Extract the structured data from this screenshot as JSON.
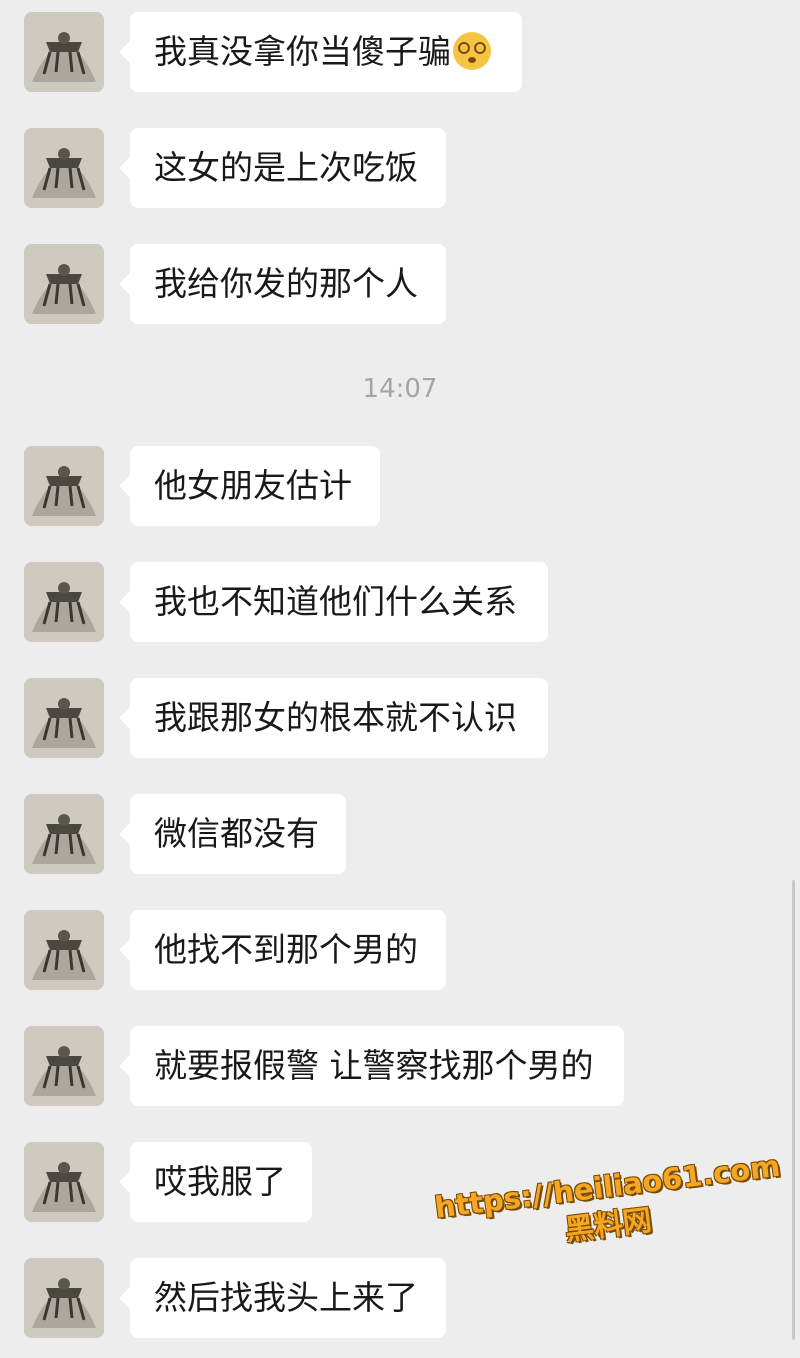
{
  "messages": [
    {
      "text": "我真没拿你当傻子骗",
      "emoji": "dizzy-face-emoji"
    },
    {
      "text": "这女的是上次吃饭"
    },
    {
      "text": "我给你发的那个人"
    },
    {
      "text": "他女朋友估计"
    },
    {
      "text": "我也不知道他们什么关系"
    },
    {
      "text": "我跟那女的根本就不认识"
    },
    {
      "text": "微信都没有"
    },
    {
      "text": "他找不到那个男的"
    },
    {
      "text": "就要报假警 让警察找那个男的"
    },
    {
      "text": "哎我服了"
    },
    {
      "text": "然后找我头上来了"
    }
  ],
  "timestamp": "14:07",
  "watermark": {
    "url": "https://heiliao61.com",
    "name": "黑料网"
  },
  "colors": {
    "background": "#ededed",
    "bubble": "#ffffff",
    "text": "#191919",
    "timestamp": "#a5a5a5",
    "watermark": "#f5a623"
  },
  "icons": {
    "avatar": "avatar-image",
    "emoji": "dizzy-face-emoji"
  }
}
